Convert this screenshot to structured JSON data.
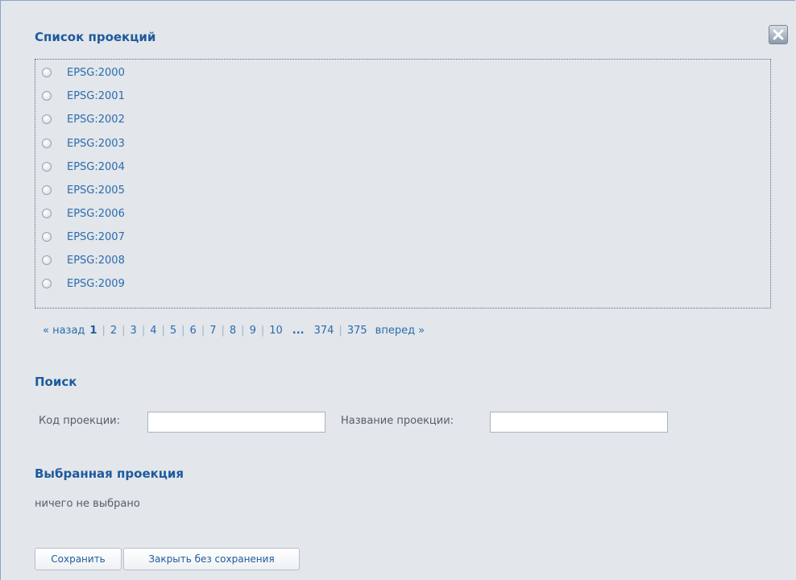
{
  "dialog": {
    "close_icon": "close-icon"
  },
  "projection_list": {
    "title": "Список проекций",
    "items": [
      {
        "label": "EPSG:2000",
        "selected": false
      },
      {
        "label": "EPSG:2001",
        "selected": false
      },
      {
        "label": "EPSG:2002",
        "selected": false
      },
      {
        "label": "EPSG:2003",
        "selected": false
      },
      {
        "label": "EPSG:2004",
        "selected": false
      },
      {
        "label": "EPSG:2005",
        "selected": false
      },
      {
        "label": "EPSG:2006",
        "selected": false
      },
      {
        "label": "EPSG:2007",
        "selected": false
      },
      {
        "label": "EPSG:2008",
        "selected": false
      },
      {
        "label": "EPSG:2009",
        "selected": false
      }
    ]
  },
  "pagination": {
    "prev_label": "« назад",
    "next_label": "вперед »",
    "ellipsis": "...",
    "current_page": "1",
    "pages": [
      "1",
      "2",
      "3",
      "4",
      "5",
      "6",
      "7",
      "8",
      "9",
      "10"
    ],
    "last_pages": [
      "374",
      "375"
    ]
  },
  "search": {
    "title": "Поиск",
    "code_label": "Код проекции:",
    "code_value": "",
    "name_label": "Название проекции:",
    "name_value": ""
  },
  "selected_projection": {
    "title": "Выбранная проекция",
    "value": "ничего не выбрано"
  },
  "buttons": {
    "save_label": "Сохранить",
    "close_without_save_label": "Закрыть без сохранения"
  },
  "colors": {
    "background": "#e3e6ea",
    "heading": "#1e5a9e",
    "link": "#2a6cb0",
    "text": "#555e6a"
  }
}
